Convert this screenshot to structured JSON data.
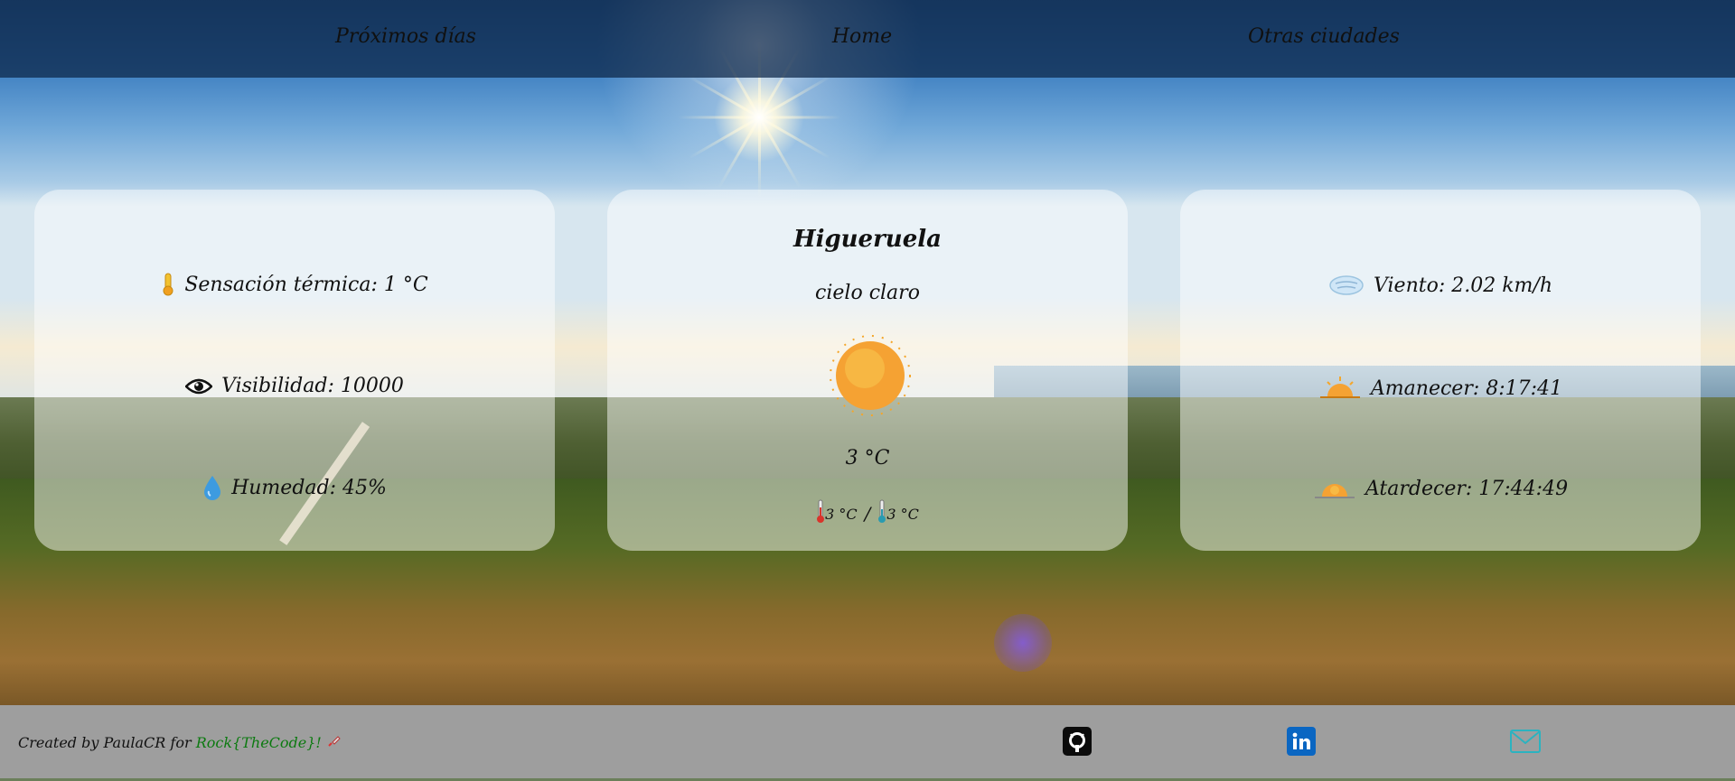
{
  "nav": {
    "items": [
      {
        "label": "Próximos días"
      },
      {
        "label": "Home"
      },
      {
        "label": "Otras ciudades"
      }
    ]
  },
  "left_card": {
    "feels_like": "Sensación térmica: 1 °C",
    "visibility": "Visibilidad: 10000",
    "humidity": "Humedad: 45%"
  },
  "center_card": {
    "city": "Higueruela",
    "description": "cielo claro",
    "temperature": "3 °C",
    "temp_max": "3 °C",
    "separator": "/",
    "temp_min": "3 °C",
    "weather_icon": "sun-icon"
  },
  "right_card": {
    "wind": "Viento: 2.02 km/h",
    "sunrise": "Amanecer: 8:17:41",
    "sunset": "Atardecer: 17:44:49"
  },
  "footer": {
    "credit_prefix": "Created by PaulaCR for ",
    "credit_brand": "Rock{TheCode}!",
    "social_icons": [
      "github-icon",
      "linkedin-icon",
      "email-icon"
    ]
  },
  "colors": {
    "navbar": "#1b3a5c",
    "footer": "#9e9e9e",
    "brand_link": "#0c7a10",
    "card_overlay": "#ffffff",
    "linkedin": "#0a66c2",
    "email": "#2bb3c0"
  }
}
